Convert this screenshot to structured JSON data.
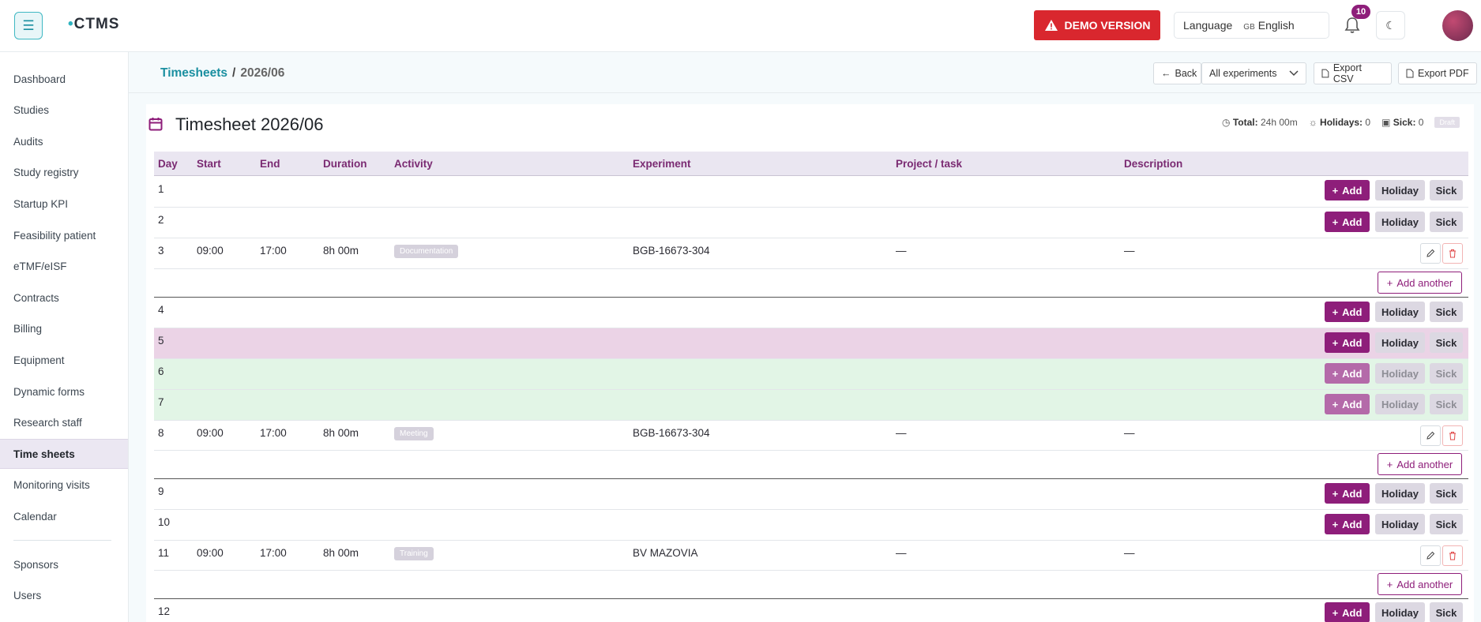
{
  "app": {
    "logo": "CTMS"
  },
  "topbar": {
    "demo_label": "DEMO VERSION",
    "language_label": "Language",
    "language_flag": "GB",
    "language_value": "English",
    "notifications_count": "10"
  },
  "sidebar": {
    "items": [
      {
        "label": "Dashboard"
      },
      {
        "label": "Studies"
      },
      {
        "label": "Audits"
      },
      {
        "label": "Study registry"
      },
      {
        "label": "Startup KPI"
      },
      {
        "label": "Feasibility patient"
      },
      {
        "label": "eTMF/eISF"
      },
      {
        "label": "Contracts"
      },
      {
        "label": "Billing"
      },
      {
        "label": "Equipment"
      },
      {
        "label": "Dynamic forms"
      },
      {
        "label": "Research staff"
      },
      {
        "label": "Time sheets"
      },
      {
        "label": "Monitoring visits"
      },
      {
        "label": "Calendar"
      },
      {
        "label": "Sponsors"
      },
      {
        "label": "Users"
      }
    ],
    "active": "Time sheets"
  },
  "breadcrumb": {
    "parent": "Timesheets",
    "separator": "/",
    "current": "2026/06"
  },
  "toolbar": {
    "back_label": "Back",
    "filter_value": "All experiments",
    "export_csv_label": "Export CSV",
    "export_pdf_label": "Export PDF"
  },
  "timesheet": {
    "title": "Timesheet 2026/06",
    "total_label": "Total:",
    "total_value": "24h 00m",
    "holidays_label": "Holidays:",
    "holidays_value": "0",
    "sick_label": "Sick:",
    "sick_value": "0",
    "status": "Draft"
  },
  "columns": [
    "Day",
    "Start",
    "End",
    "Duration",
    "Activity",
    "Experiment",
    "Project / task",
    "Description"
  ],
  "actions": {
    "add_label": "Add",
    "holiday_label": "Holiday",
    "sick_label": "Sick",
    "add_another_label": "Add another"
  },
  "rows": [
    {
      "day": "1"
    },
    {
      "day": "2"
    },
    {
      "day": "3",
      "start": "09:00",
      "end": "17:00",
      "duration": "8h 00m",
      "activity": "Documentation",
      "experiment": "BGB-16673-304",
      "project": "—",
      "description": "—"
    },
    {
      "day": "4"
    },
    {
      "day": "5",
      "style": "pink"
    },
    {
      "day": "6",
      "style": "green"
    },
    {
      "day": "7",
      "style": "green"
    },
    {
      "day": "8",
      "start": "09:00",
      "end": "17:00",
      "duration": "8h 00m",
      "activity": "Meeting",
      "experiment": "BGB-16673-304",
      "project": "—",
      "description": "—"
    },
    {
      "day": "9"
    },
    {
      "day": "10"
    },
    {
      "day": "11",
      "start": "09:00",
      "end": "17:00",
      "duration": "8h 00m",
      "activity": "Training",
      "experiment": "BV MAZOVIA",
      "project": "—",
      "description": "—"
    },
    {
      "day": "12"
    }
  ]
}
